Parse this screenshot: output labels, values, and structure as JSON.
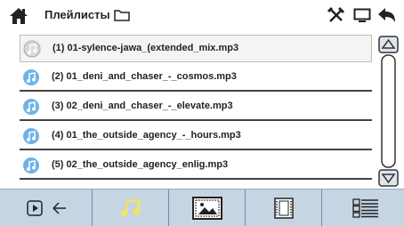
{
  "header": {
    "title": "Плейлисты",
    "icons": [
      "home-icon",
      "folder-icon",
      "tools-icon",
      "monitor-icon",
      "back-icon"
    ]
  },
  "playlist": {
    "items": [
      {
        "label": "(1)  01-sylence-jawa_(extended_mix.mp3",
        "selected": true
      },
      {
        "label": "(2)  01_deni_and_chaser_-_cosmos.mp3",
        "selected": false
      },
      {
        "label": "(3)  02_deni_and_chaser_-_elevate.mp3",
        "selected": false
      },
      {
        "label": "(4)  01_the_outside_agency_-_hours.mp3",
        "selected": false
      },
      {
        "label": "(5)  02_the_outside_agency_enlig.mp3",
        "selected": false
      }
    ]
  },
  "bottom_tabs": [
    "play-back-tab",
    "music-tab",
    "picture-tab",
    "video-tab",
    "list-view-tab"
  ],
  "colors": {
    "accent_yellow": "#f6e35a",
    "badge_blue": "#6fb3e6",
    "bar_bg": "#c5d5e4"
  }
}
